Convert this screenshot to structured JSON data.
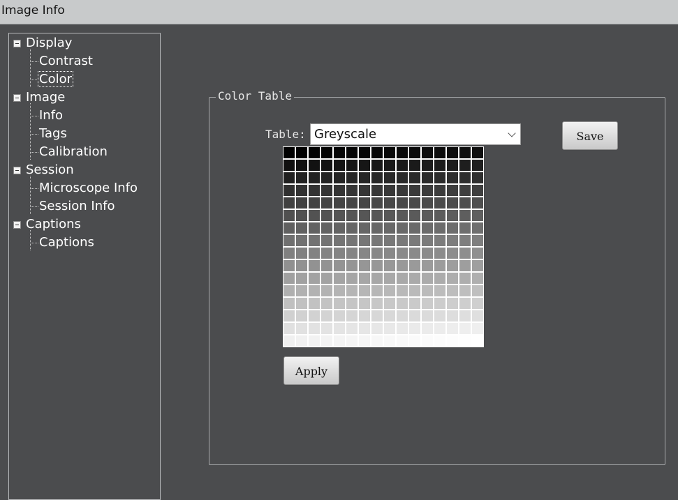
{
  "window": {
    "title": "Image Info"
  },
  "tree": {
    "groups": [
      {
        "label": "Display",
        "children": [
          "Contrast",
          "Color"
        ]
      },
      {
        "label": "Image",
        "children": [
          "Info",
          "Tags",
          "Calibration"
        ]
      },
      {
        "label": "Session",
        "children": [
          "Microscope Info",
          "Session Info"
        ]
      },
      {
        "label": "Captions",
        "children": [
          "Captions"
        ]
      }
    ],
    "selected": "Color"
  },
  "color_table": {
    "group_title": "Color Table",
    "table_label": "Table:",
    "table_value": "Greyscale",
    "save_label": "Save",
    "apply_label": "Apply",
    "grid_rows": 16,
    "grid_cols": 16,
    "ramp": "greyscale"
  }
}
